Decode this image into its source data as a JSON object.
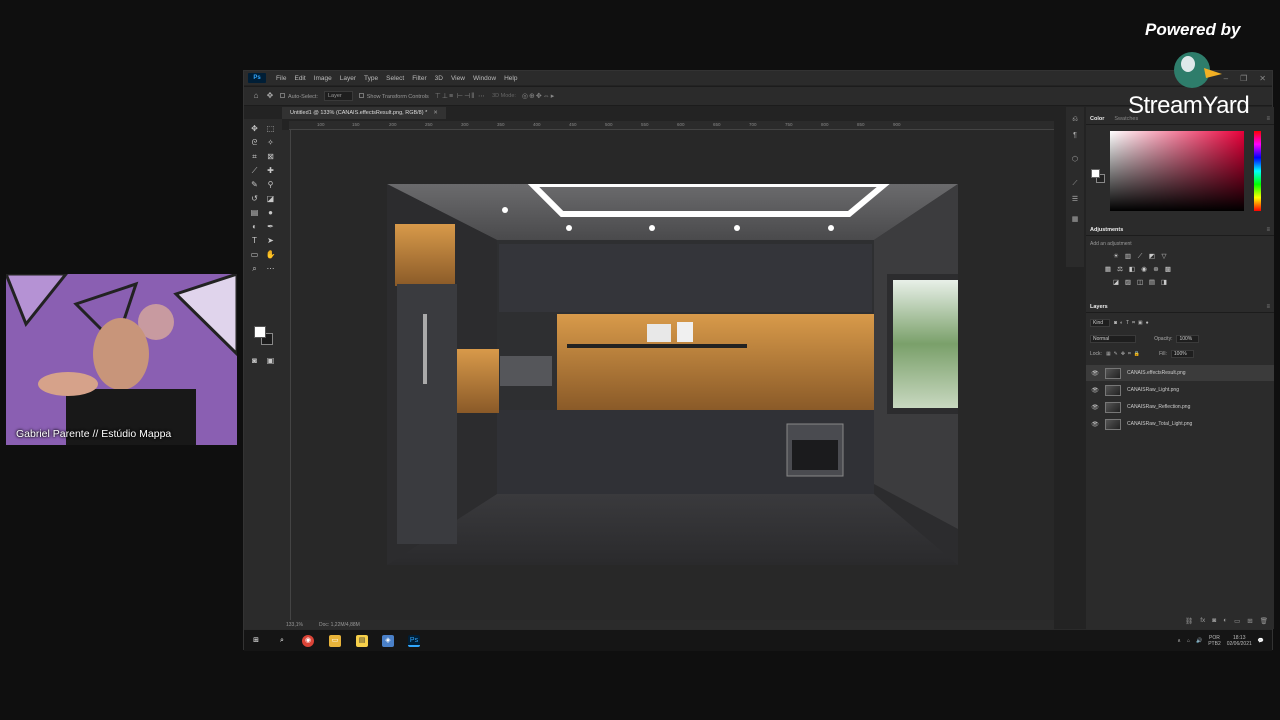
{
  "menu": {
    "app_logo": "Ps",
    "items": [
      "File",
      "Edit",
      "Image",
      "Layer",
      "Type",
      "Select",
      "Filter",
      "3D",
      "View",
      "Window",
      "Help"
    ]
  },
  "options": {
    "auto_select_label": "Auto-Select:",
    "auto_select_value": "Layer",
    "transform_label": "Show Transform Controls",
    "mode_label": "3D Mode:"
  },
  "document": {
    "tab_title": "Untitled1 @ 133% (CANAIS.effectsResult.png, RGB/8) *",
    "zoom": "133,1%",
    "doc_size": "Doc: 1,22M/4,88M"
  },
  "ruler": {
    "top": [
      "100",
      "150",
      "200",
      "250",
      "300",
      "350",
      "400",
      "450",
      "500",
      "550",
      "600",
      "650",
      "700",
      "750",
      "800",
      "850",
      "900"
    ]
  },
  "panels": {
    "color_tab": "Color",
    "swatches_tab": "Swatches",
    "adjustments_tab": "Adjustments",
    "adjustments_hint": "Add an adjustment",
    "layers_tab": "Layers",
    "filter_kind": "Kind",
    "blend_mode": "Normal",
    "opacity_label": "Opacity:",
    "opacity_value": "100%",
    "lock_label": "Lock:",
    "fill_label": "Fill:",
    "fill_value": "100%"
  },
  "layers": [
    {
      "name": "CANAIS.effectsResult.png",
      "active": true
    },
    {
      "name": "CANAISRaw_Light.png",
      "active": false
    },
    {
      "name": "CANAISRaw_Reflection.png",
      "active": false
    },
    {
      "name": "CANAISRaw_Total_Light.png",
      "active": false
    }
  ],
  "taskbar": {
    "lang_top": "POR",
    "lang_bottom": "PTB2",
    "time": "18:13",
    "date": "02/06/2021"
  },
  "webcam": {
    "name": "Gabriel Parente // Estúdio Mappa"
  },
  "branding": {
    "powered_by": "Powered by",
    "logo_text": "StreamYard"
  },
  "colors": {
    "ps_accent": "#31a8ff",
    "foreground": "#ffffff",
    "picker_hue": "#e8003a",
    "webcam_wall": "#8a5fb2"
  }
}
